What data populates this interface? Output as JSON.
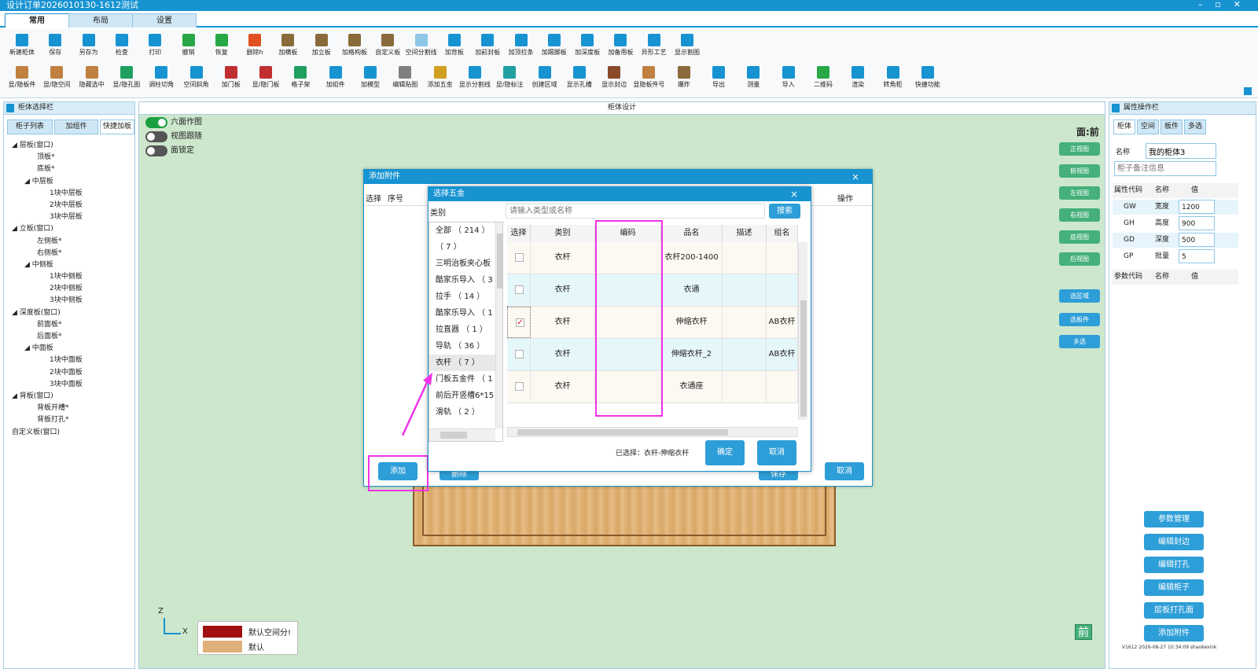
{
  "window": {
    "title": "设计订单2026010130-1612测试",
    "min": "–",
    "max": "▫",
    "close": "✕"
  },
  "ribbon_tabs": [
    "常用",
    "布局",
    "设置"
  ],
  "toolbar_row1": [
    {
      "label": "新建柜体",
      "color": "#1793d1"
    },
    {
      "label": "保存",
      "color": "#1793d1"
    },
    {
      "label": "另存为",
      "color": "#1793d1"
    },
    {
      "label": "检查",
      "color": "#1793d1"
    },
    {
      "label": "打印",
      "color": "#1793d1"
    },
    {
      "label": "撤销",
      "color": "#28a745"
    },
    {
      "label": "恢复",
      "color": "#28a745"
    },
    {
      "label": "删除h",
      "color": "#e05020"
    },
    {
      "label": "加横板",
      "color": "#8a6a3a"
    },
    {
      "label": "加立板",
      "color": "#8a6a3a"
    },
    {
      "label": "加格构板",
      "color": "#8a6a3a"
    },
    {
      "label": "自定义板",
      "color": "#8a6a3a"
    },
    {
      "label": "空间分割线",
      "color": "#8ec6e6"
    },
    {
      "label": "加背板",
      "color": "#1793d1"
    },
    {
      "label": "加前封板",
      "color": "#1793d1"
    },
    {
      "label": "加顶拉条",
      "color": "#1793d1"
    },
    {
      "label": "加踢脚板",
      "color": "#1793d1"
    },
    {
      "label": "加深度板",
      "color": "#1793d1"
    },
    {
      "label": "加备用板",
      "color": "#1793d1"
    },
    {
      "label": "异形工艺",
      "color": "#1793d1"
    },
    {
      "label": "显示割图",
      "color": "#1793d1"
    }
  ],
  "toolbar_row2": [
    {
      "label": "显/隐板件",
      "color": "#c08040"
    },
    {
      "label": "显/隐空间",
      "color": "#c08040"
    },
    {
      "label": "隐藏选中",
      "color": "#c08040"
    },
    {
      "label": "显/隐孔图",
      "color": "#20a060"
    },
    {
      "label": "调柱切角",
      "color": "#1793d1"
    },
    {
      "label": "空间斜角",
      "color": "#1793d1"
    },
    {
      "label": "加门板",
      "color": "#c03030"
    },
    {
      "label": "显/隐门板",
      "color": "#c03030"
    },
    {
      "label": "格子架",
      "color": "#20a060"
    },
    {
      "label": "加组件",
      "color": "#1793d1"
    },
    {
      "label": "加模型",
      "color": "#1793d1"
    },
    {
      "label": "编辑贴图",
      "color": "#808080"
    },
    {
      "label": "添加五金",
      "color": "#d0a020"
    },
    {
      "label": "显示分割线",
      "color": "#1793d1"
    },
    {
      "label": "显/隐标注",
      "color": "#20a0a0"
    },
    {
      "label": "创建区域",
      "color": "#1793d1"
    },
    {
      "label": "显示孔槽",
      "color": "#1793d1"
    },
    {
      "label": "显示封边",
      "color": "#8a4a2a"
    },
    {
      "label": "显隐板件号",
      "color": "#c08040"
    },
    {
      "label": "爆炸",
      "color": "#8a6a3a"
    },
    {
      "label": "导出",
      "color": "#1793d1"
    },
    {
      "label": "测量",
      "color": "#1793d1"
    },
    {
      "label": "导入",
      "color": "#1793d1"
    },
    {
      "label": "二维码",
      "color": "#28a745"
    },
    {
      "label": "渲染",
      "color": "#1793d1"
    },
    {
      "label": "转角柜",
      "color": "#1793d1"
    },
    {
      "label": "快捷功能",
      "color": "#1793d1"
    }
  ],
  "left_panel": {
    "title": "柜体选择栏",
    "tabs": [
      "柜子列表",
      "加组件",
      "快捷加板"
    ],
    "tree": [
      {
        "t": "◢ 层板(窗口)",
        "d": 0
      },
      {
        "t": "顶板*",
        "d": 2
      },
      {
        "t": "底板*",
        "d": 2
      },
      {
        "t": "◢ 中层板",
        "d": 1
      },
      {
        "t": "1块中层板",
        "d": 3
      },
      {
        "t": "2块中层板",
        "d": 3
      },
      {
        "t": "3块中层板",
        "d": 3
      },
      {
        "t": "◢ 立板(窗口)",
        "d": 0
      },
      {
        "t": "左侧板*",
        "d": 2
      },
      {
        "t": "右侧板*",
        "d": 2
      },
      {
        "t": "◢ 中侧板",
        "d": 1
      },
      {
        "t": "1块中侧板",
        "d": 3
      },
      {
        "t": "2块中侧板",
        "d": 3
      },
      {
        "t": "3块中侧板",
        "d": 3
      },
      {
        "t": "◢ 深度板(窗口)",
        "d": 0
      },
      {
        "t": "前面板*",
        "d": 2
      },
      {
        "t": "后面板*",
        "d": 2
      },
      {
        "t": "◢ 中面板",
        "d": 1
      },
      {
        "t": "1块中面板",
        "d": 3
      },
      {
        "t": "2块中面板",
        "d": 3
      },
      {
        "t": "3块中面板",
        "d": 3
      },
      {
        "t": "◢ 背板(窗口)",
        "d": 0
      },
      {
        "t": "背板开槽*",
        "d": 2
      },
      {
        "t": "背板打孔*",
        "d": 2
      },
      {
        "t": "自定义板(窗口)",
        "d": 0
      }
    ]
  },
  "center": {
    "title": "柜体设计",
    "toggles": [
      {
        "label": "六面作图",
        "on": true
      },
      {
        "label": "视图跟随",
        "on": false
      },
      {
        "label": "面锁定",
        "on": false
      }
    ],
    "view_label": "面:前",
    "view_buttons": [
      "正视图",
      "俯视图",
      "左视图",
      "右视图",
      "底视图",
      "后视图"
    ],
    "select_buttons": [
      "选区域",
      "选板件",
      "多选"
    ],
    "legend": [
      {
        "label": "默认空间分!",
        "color": "#a01010"
      },
      {
        "label": "默认",
        "color": "#e0b07a"
      }
    ],
    "axis": {
      "z": "Z",
      "x": "X"
    },
    "cube_label": "前"
  },
  "right_panel": {
    "title": "属性操作栏",
    "tabs": [
      "柜体",
      "空间",
      "板件",
      "多选"
    ],
    "name_label": "名称",
    "name_value": "我的柜体3",
    "note_placeholder": "柜子备注信息",
    "headers": [
      "属性代码",
      "名称",
      "值"
    ],
    "props": [
      {
        "code": "GW",
        "name": "宽度",
        "value": "1200"
      },
      {
        "code": "GH",
        "name": "高度",
        "value": "900"
      },
      {
        "code": "GD",
        "name": "深度",
        "value": "500"
      },
      {
        "code": "GP",
        "name": "批量",
        "value": "5"
      }
    ],
    "param_headers": [
      "参数代码",
      "名称",
      "值"
    ],
    "buttons": [
      "参数管理",
      "编辑封边",
      "编辑打孔",
      "编辑柜子",
      "层板打孔面",
      "添加附件"
    ],
    "version": "V1612 2026-08-27 10:34:09 shaokexink"
  },
  "dialog_outer": {
    "title": "添加附件",
    "close": "×",
    "headers": [
      "选择",
      "序号"
    ],
    "op_header": "操作",
    "add_button": "添加",
    "delete_button": "删除",
    "save_button": "保存",
    "cancel_button": "取消"
  },
  "dialog_inner": {
    "title": "选择五金",
    "close": "×",
    "category_label": "类别",
    "search_placeholder": "请输入类型或名称",
    "search_button": "搜索",
    "categories": [
      "全部 （ 214 ）",
      "（ 7 ）",
      "三明治板夹心板",
      "酷家乐导入 （ 3",
      "拉手 （ 14 ）",
      "酷家乐导入 （ 1",
      "拉直器 （ 1 ）",
      "导轨 （ 36 ）",
      "衣杆 （ 7 ）",
      "门板五金件 （ 1",
      "前后开竖槽6*15",
      "滑轨 （ 2 ）"
    ],
    "selected_category_index": 8,
    "grid_headers": [
      "选择",
      "类别",
      "编码",
      "品名",
      "描述",
      "组名"
    ],
    "rows": [
      {
        "checked": false,
        "type": "衣杆",
        "code": "",
        "name": "衣杆200-1400",
        "desc": "",
        "group": ""
      },
      {
        "checked": false,
        "type": "衣杆",
        "code": "",
        "name": "衣通",
        "desc": "",
        "group": ""
      },
      {
        "checked": true,
        "type": "衣杆",
        "code": "",
        "name": "伸缩衣杆",
        "desc": "",
        "group": "AB衣杆"
      },
      {
        "checked": false,
        "type": "衣杆",
        "code": "",
        "name": "伸缩衣杆_2",
        "desc": "",
        "group": "AB衣杆"
      },
      {
        "checked": false,
        "type": "衣杆",
        "code": "",
        "name": "衣通座",
        "desc": "",
        "group": ""
      }
    ],
    "selected_text": "已选择：衣杆-伸缩衣杆",
    "ok_button": "确定",
    "cancel_button": "取消"
  }
}
